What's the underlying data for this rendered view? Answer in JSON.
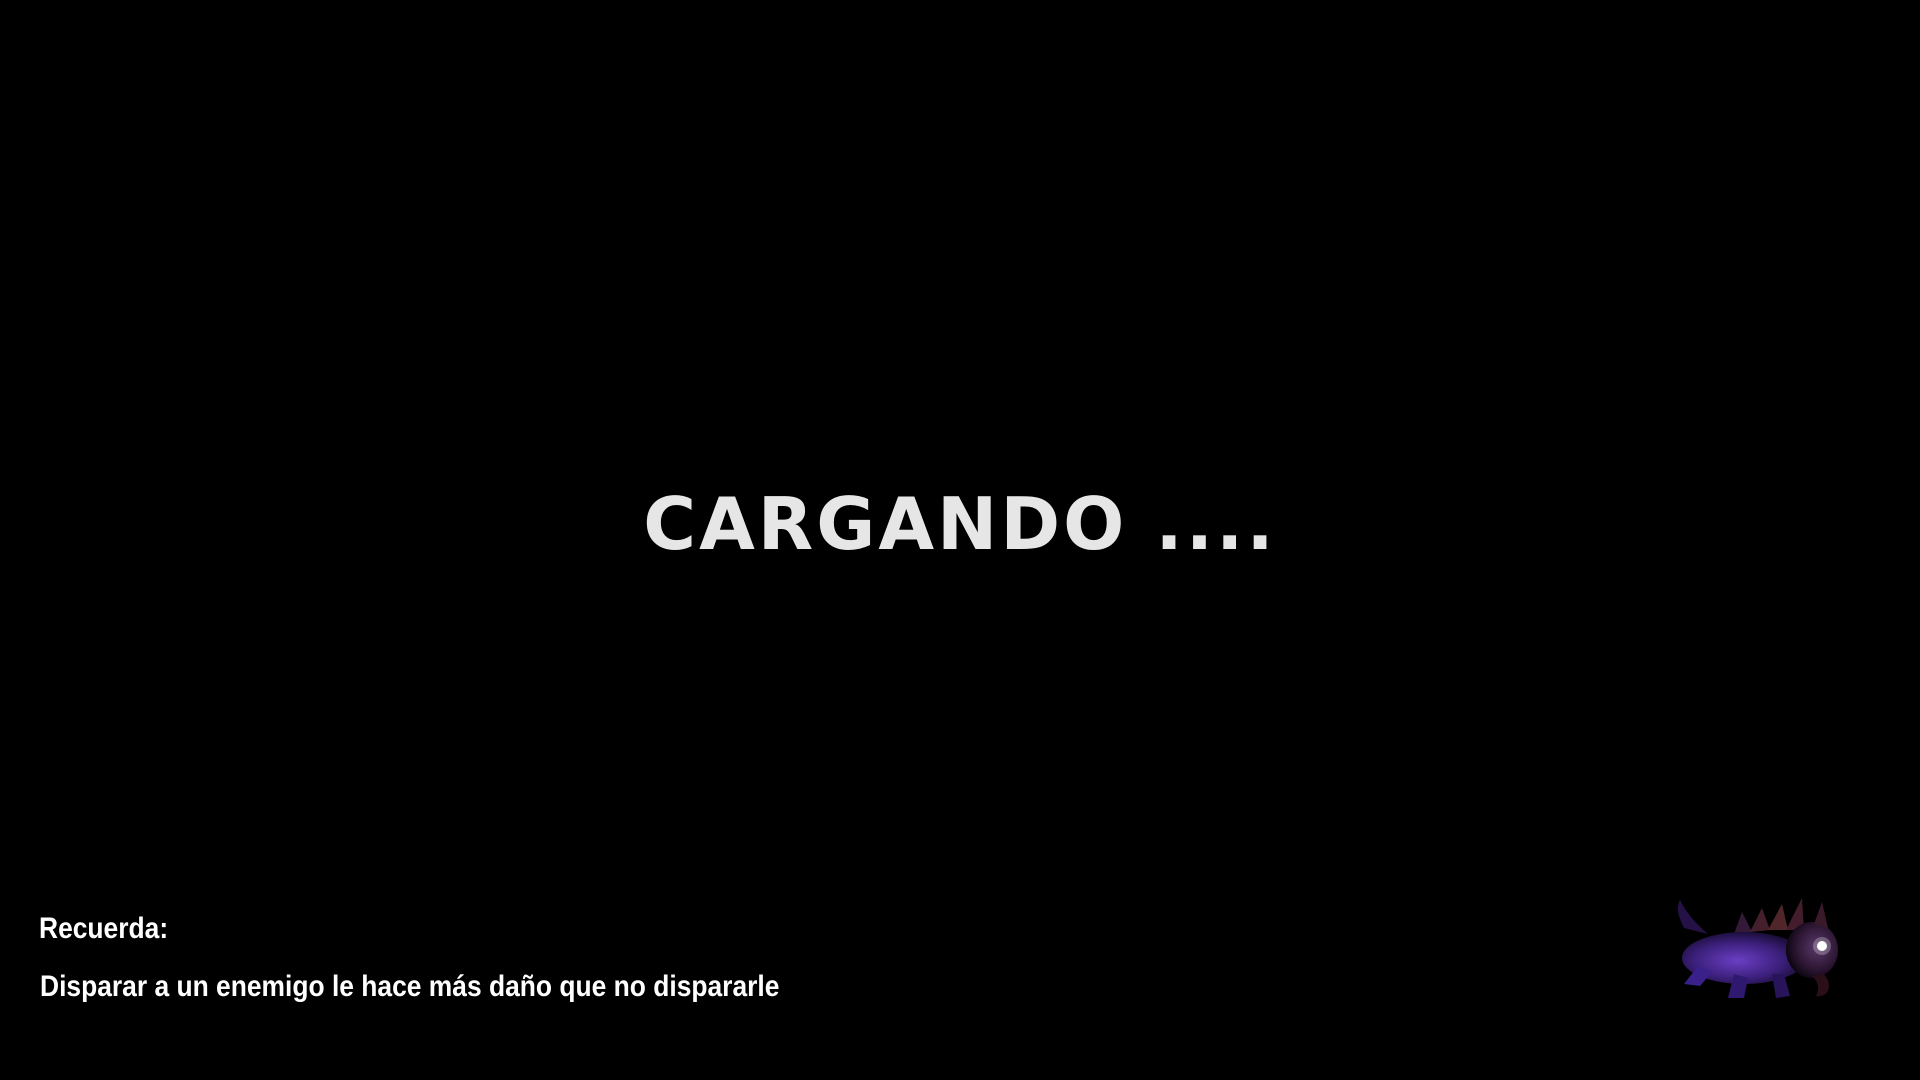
{
  "loading": {
    "title": "CARGANDO ...."
  },
  "tip": {
    "heading": "Recuerda:",
    "text": "Disparar a un enemigo le hace más daño que no dispararle"
  },
  "loading_icon": {
    "name": "purple-creature-icon",
    "color": "#4a2a8a"
  },
  "colors": {
    "background": "#000000",
    "title": "#e6e6e6",
    "tip_text": "#ffffff"
  }
}
